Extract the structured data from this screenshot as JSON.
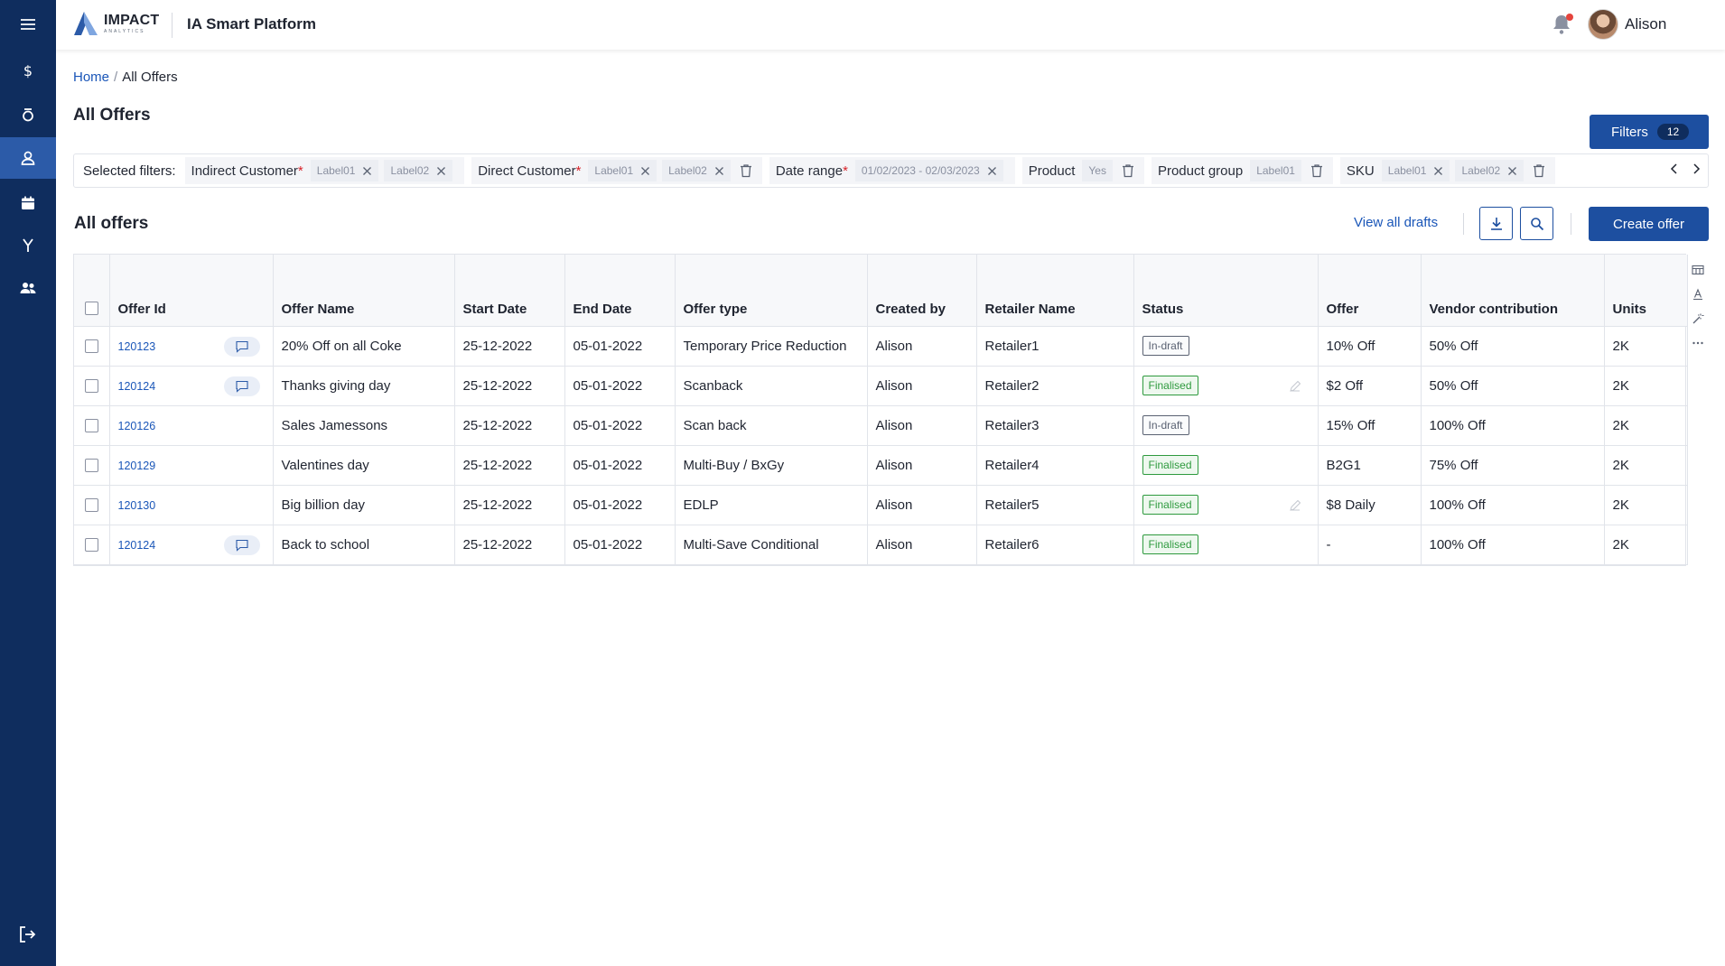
{
  "brand": {
    "logo_word": "IMPACT",
    "logo_sub": "ANALYTICS",
    "app_title": "IA Smart Platform"
  },
  "colors": {
    "rail": "#0f2d5e",
    "rail_active": "#2c5ba8",
    "primary": "#1d4fa0",
    "link": "#1a56b8",
    "finalised": "#2e9a3e",
    "draft": "#5a6272"
  },
  "rail_icons": [
    "menu-icon",
    "dollar-icon",
    "timer-icon",
    "user-profile-icon",
    "calendar-icon",
    "fork-icon",
    "people-icon",
    "logout-icon"
  ],
  "user": {
    "name": "Alison"
  },
  "breadcrumb": {
    "home": "Home",
    "separator": "/",
    "current": "All Offers"
  },
  "page_title": "All Offers",
  "filters_button": {
    "label": "Filters",
    "count": "12"
  },
  "selected_filters": {
    "label": "Selected filters:",
    "groups": [
      {
        "name": "Indirect Customer",
        "required": "*",
        "chips": [
          "Label01",
          "Label02"
        ]
      },
      {
        "name": "Direct Customer",
        "required": "*",
        "chips": [
          "Label01",
          "Label02"
        ]
      },
      {
        "name": "Date range",
        "required": "*",
        "chips": [
          "01/02/2023 - 02/03/2023"
        ]
      },
      {
        "name": "Product",
        "chips": [
          "Yes"
        ]
      },
      {
        "name": "Product group",
        "chips": [
          "Label01"
        ]
      },
      {
        "name": "SKU",
        "chips": [
          "Label01",
          "Label02"
        ]
      }
    ]
  },
  "section": {
    "title": "All offers",
    "view_drafts": "View all drafts",
    "create_offer": "Create offer"
  },
  "table": {
    "columns": [
      "Offer Id",
      "Offer Name",
      "Start Date",
      "End Date",
      "Offer type",
      "Created by",
      "Retailer Name",
      "Status",
      "Offer",
      "Vendor contribution",
      "Units"
    ],
    "rows": [
      {
        "id": "120123",
        "comment": true,
        "name": "20% Off on all Coke",
        "start": "25-12-2022",
        "end": "05-01-2022",
        "type": "Temporary Price Reduction",
        "created_by": "Alison",
        "retailer": "Retailer1",
        "status": "In-draft",
        "status_kind": "draft",
        "edit": false,
        "offer": "10% Off",
        "vendor": "50% Off",
        "units": "2K"
      },
      {
        "id": "120124",
        "comment": true,
        "name": "Thanks giving day",
        "start": "25-12-2022",
        "end": "05-01-2022",
        "type": "Scanback",
        "created_by": "Alison",
        "retailer": "Retailer2",
        "status": "Finalised",
        "status_kind": "final",
        "edit": true,
        "offer": "$2 Off",
        "vendor": "50% Off",
        "units": "2K"
      },
      {
        "id": "120126",
        "comment": false,
        "name": "Sales Jamessons",
        "start": "25-12-2022",
        "end": "05-01-2022",
        "type": "Scan back",
        "created_by": "Alison",
        "retailer": "Retailer3",
        "status": "In-draft",
        "status_kind": "draft",
        "edit": false,
        "offer": "15% Off",
        "vendor": "100% Off",
        "units": "2K"
      },
      {
        "id": "120129",
        "comment": false,
        "name": "Valentines day",
        "start": "25-12-2022",
        "end": "05-01-2022",
        "type": "Multi-Buy / BxGy",
        "created_by": "Alison",
        "retailer": "Retailer4",
        "status": "Finalised",
        "status_kind": "final",
        "edit": false,
        "offer": "B2G1",
        "vendor": "75% Off",
        "units": "2K"
      },
      {
        "id": "120130",
        "comment": false,
        "name": "Big billion day",
        "start": "25-12-2022",
        "end": "05-01-2022",
        "type": "EDLP",
        "created_by": "Alison",
        "retailer": "Retailer5",
        "status": "Finalised",
        "status_kind": "final",
        "edit": true,
        "offer": "$8 Daily",
        "vendor": "100% Off",
        "units": "2K"
      },
      {
        "id": "120124",
        "comment": true,
        "name": "Back to school",
        "start": "25-12-2022",
        "end": "05-01-2022",
        "type": "Multi-Save Conditional",
        "created_by": "Alison",
        "retailer": "Retailer6",
        "status": "Finalised",
        "status_kind": "final",
        "edit": false,
        "offer": "-",
        "vendor": "100% Off",
        "units": "2K"
      }
    ]
  }
}
